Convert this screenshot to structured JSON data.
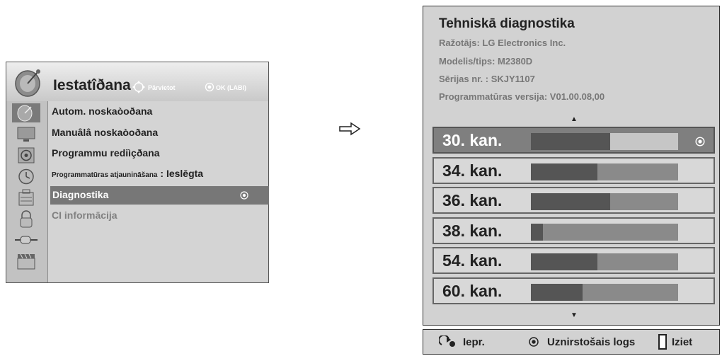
{
  "setup_menu": {
    "title": "Iestatîðana",
    "hint_move": "Pārvietot",
    "hint_ok": "OK (LABI)",
    "sidebar_icons": [
      "satellite-dish-icon",
      "tv-picture-icon",
      "speaker-audio-icon",
      "clock-time-icon",
      "lock-option-icon",
      "padlock-icon",
      "input-plug-icon",
      "media-clapper-icon"
    ],
    "items": [
      {
        "label": "Autom. noskaòoðana"
      },
      {
        "label": "Manuâlâ noskaòoðana"
      },
      {
        "label": "Programmu rediìçðana"
      },
      {
        "label": "Programmatūras atjaunināšana",
        "value": ": Ieslēgta"
      },
      {
        "label": "Diagnostika",
        "selected": true
      },
      {
        "label": "CI informācija",
        "disabled": true
      }
    ]
  },
  "diagnostics": {
    "title": "Tehniskā diagnostika",
    "manufacturer": "Ražotājs: LG Electronics Inc.",
    "model": "Modelis/tips: M2380D",
    "serial": "Sērijas nr. : SKJY1107",
    "software_version": "Programmatūras versija: V01.00.08,00",
    "scroll_up": "▲",
    "scroll_down": "▼",
    "channels": [
      {
        "name": "30. kan.",
        "signal": 0.54,
        "selected": true
      },
      {
        "name": "34. kan.",
        "signal": 0.45
      },
      {
        "name": "36. kan.",
        "signal": 0.54
      },
      {
        "name": "38. kan.",
        "signal": 0.08
      },
      {
        "name": "54. kan.",
        "signal": 0.45
      },
      {
        "name": "60. kan.",
        "signal": 0.35
      }
    ]
  },
  "footer": {
    "prev": "Iepr.",
    "popup": "Uznirstošais logs",
    "exit": "Iziet"
  },
  "colors": {
    "panel_bg": "#d2d2d2",
    "selected_bg": "#7f7f7f",
    "bar_fill": "#555555"
  }
}
